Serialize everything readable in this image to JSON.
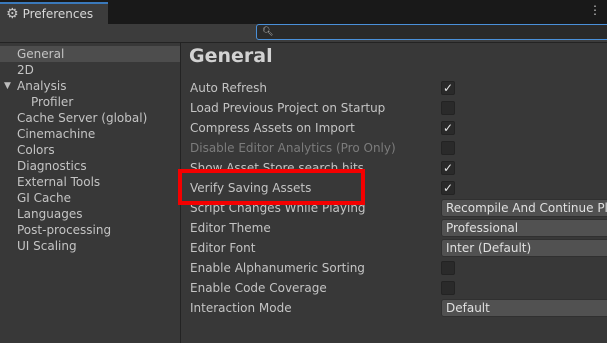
{
  "window": {
    "tab_title": "Preferences",
    "menu_icon": "kebab-icon",
    "tab_icon": "gear-icon"
  },
  "search": {
    "placeholder": "",
    "value": ""
  },
  "sidebar": {
    "items": [
      {
        "label": "General",
        "selected": true
      },
      {
        "label": "2D"
      },
      {
        "label": "Analysis",
        "expanded": true
      },
      {
        "label": "Profiler",
        "child": true
      },
      {
        "label": "Cache Server (global)"
      },
      {
        "label": "Cinemachine"
      },
      {
        "label": "Colors"
      },
      {
        "label": "Diagnostics"
      },
      {
        "label": "External Tools"
      },
      {
        "label": "GI Cache"
      },
      {
        "label": "Languages"
      },
      {
        "label": "Post-processing"
      },
      {
        "label": "UI Scaling"
      }
    ]
  },
  "main": {
    "title": "General",
    "rows": [
      {
        "label": "Auto Refresh",
        "checked": true
      },
      {
        "label": "Load Previous Project on Startup",
        "checked": false
      },
      {
        "label": "Compress Assets on Import",
        "checked": true
      },
      {
        "label": "Disable Editor Analytics (Pro Only)",
        "checked": false,
        "disabled": true
      },
      {
        "label": "Show Asset Store search hits",
        "checked": true
      },
      {
        "label": "Verify Saving Assets",
        "checked": true
      },
      {
        "label": "Script Changes While Playing",
        "value": "Recompile And Continue Playing"
      },
      {
        "label": "Editor Theme",
        "value": "Professional"
      },
      {
        "label": "Editor Font",
        "value": "Inter (Default)"
      },
      {
        "label": "Enable Alphanumeric Sorting",
        "checked": false
      },
      {
        "label": "Enable Code Coverage",
        "checked": false
      },
      {
        "label": "Interaction Mode",
        "value": "Default"
      }
    ]
  },
  "colors": {
    "highlight": "#f40000",
    "accent": "#3a79bb"
  }
}
